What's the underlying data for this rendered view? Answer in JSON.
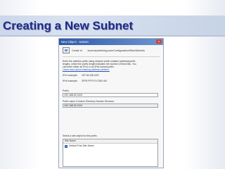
{
  "slide": {
    "title": "Creating a New Subnet"
  },
  "dialog": {
    "window_title": "New Object - Subnet",
    "close_glyph": "x",
    "create_in_label": "Create in:",
    "create_in_path": "lucernepublishing.com/Configuration/Sites/Subnets",
    "instructions_line1": "Enter the address prefix using network prefix notation (address/prefix",
    "instructions_line2": "length), where the prefix length indicates the number of fixed bits. You",
    "instructions_line3": "can enter either an IPv4 or an IPv6 subnet prefix.",
    "learn_more_link": "Learn more about entering address prefixes.",
    "ipv4_example_label": "IPv4 example:",
    "ipv4_example_value": "157.54.208.0/20",
    "ipv6_example_label": "IPv6 example:",
    "ipv6_example_value": "3FFE:FFFF:0:C000::/64",
    "prefix_label": "Prefix:",
    "prefix_value": "192.168.52.0/24",
    "prefix_name_label": "Prefix name in Active Directory Domain Services:",
    "prefix_name_value": "192.168.52.0/24",
    "site_select_label": "Select a site object for this prefix.",
    "site_column_header": "Site Name",
    "sites": [
      "Default-First-Site-Name"
    ]
  }
}
